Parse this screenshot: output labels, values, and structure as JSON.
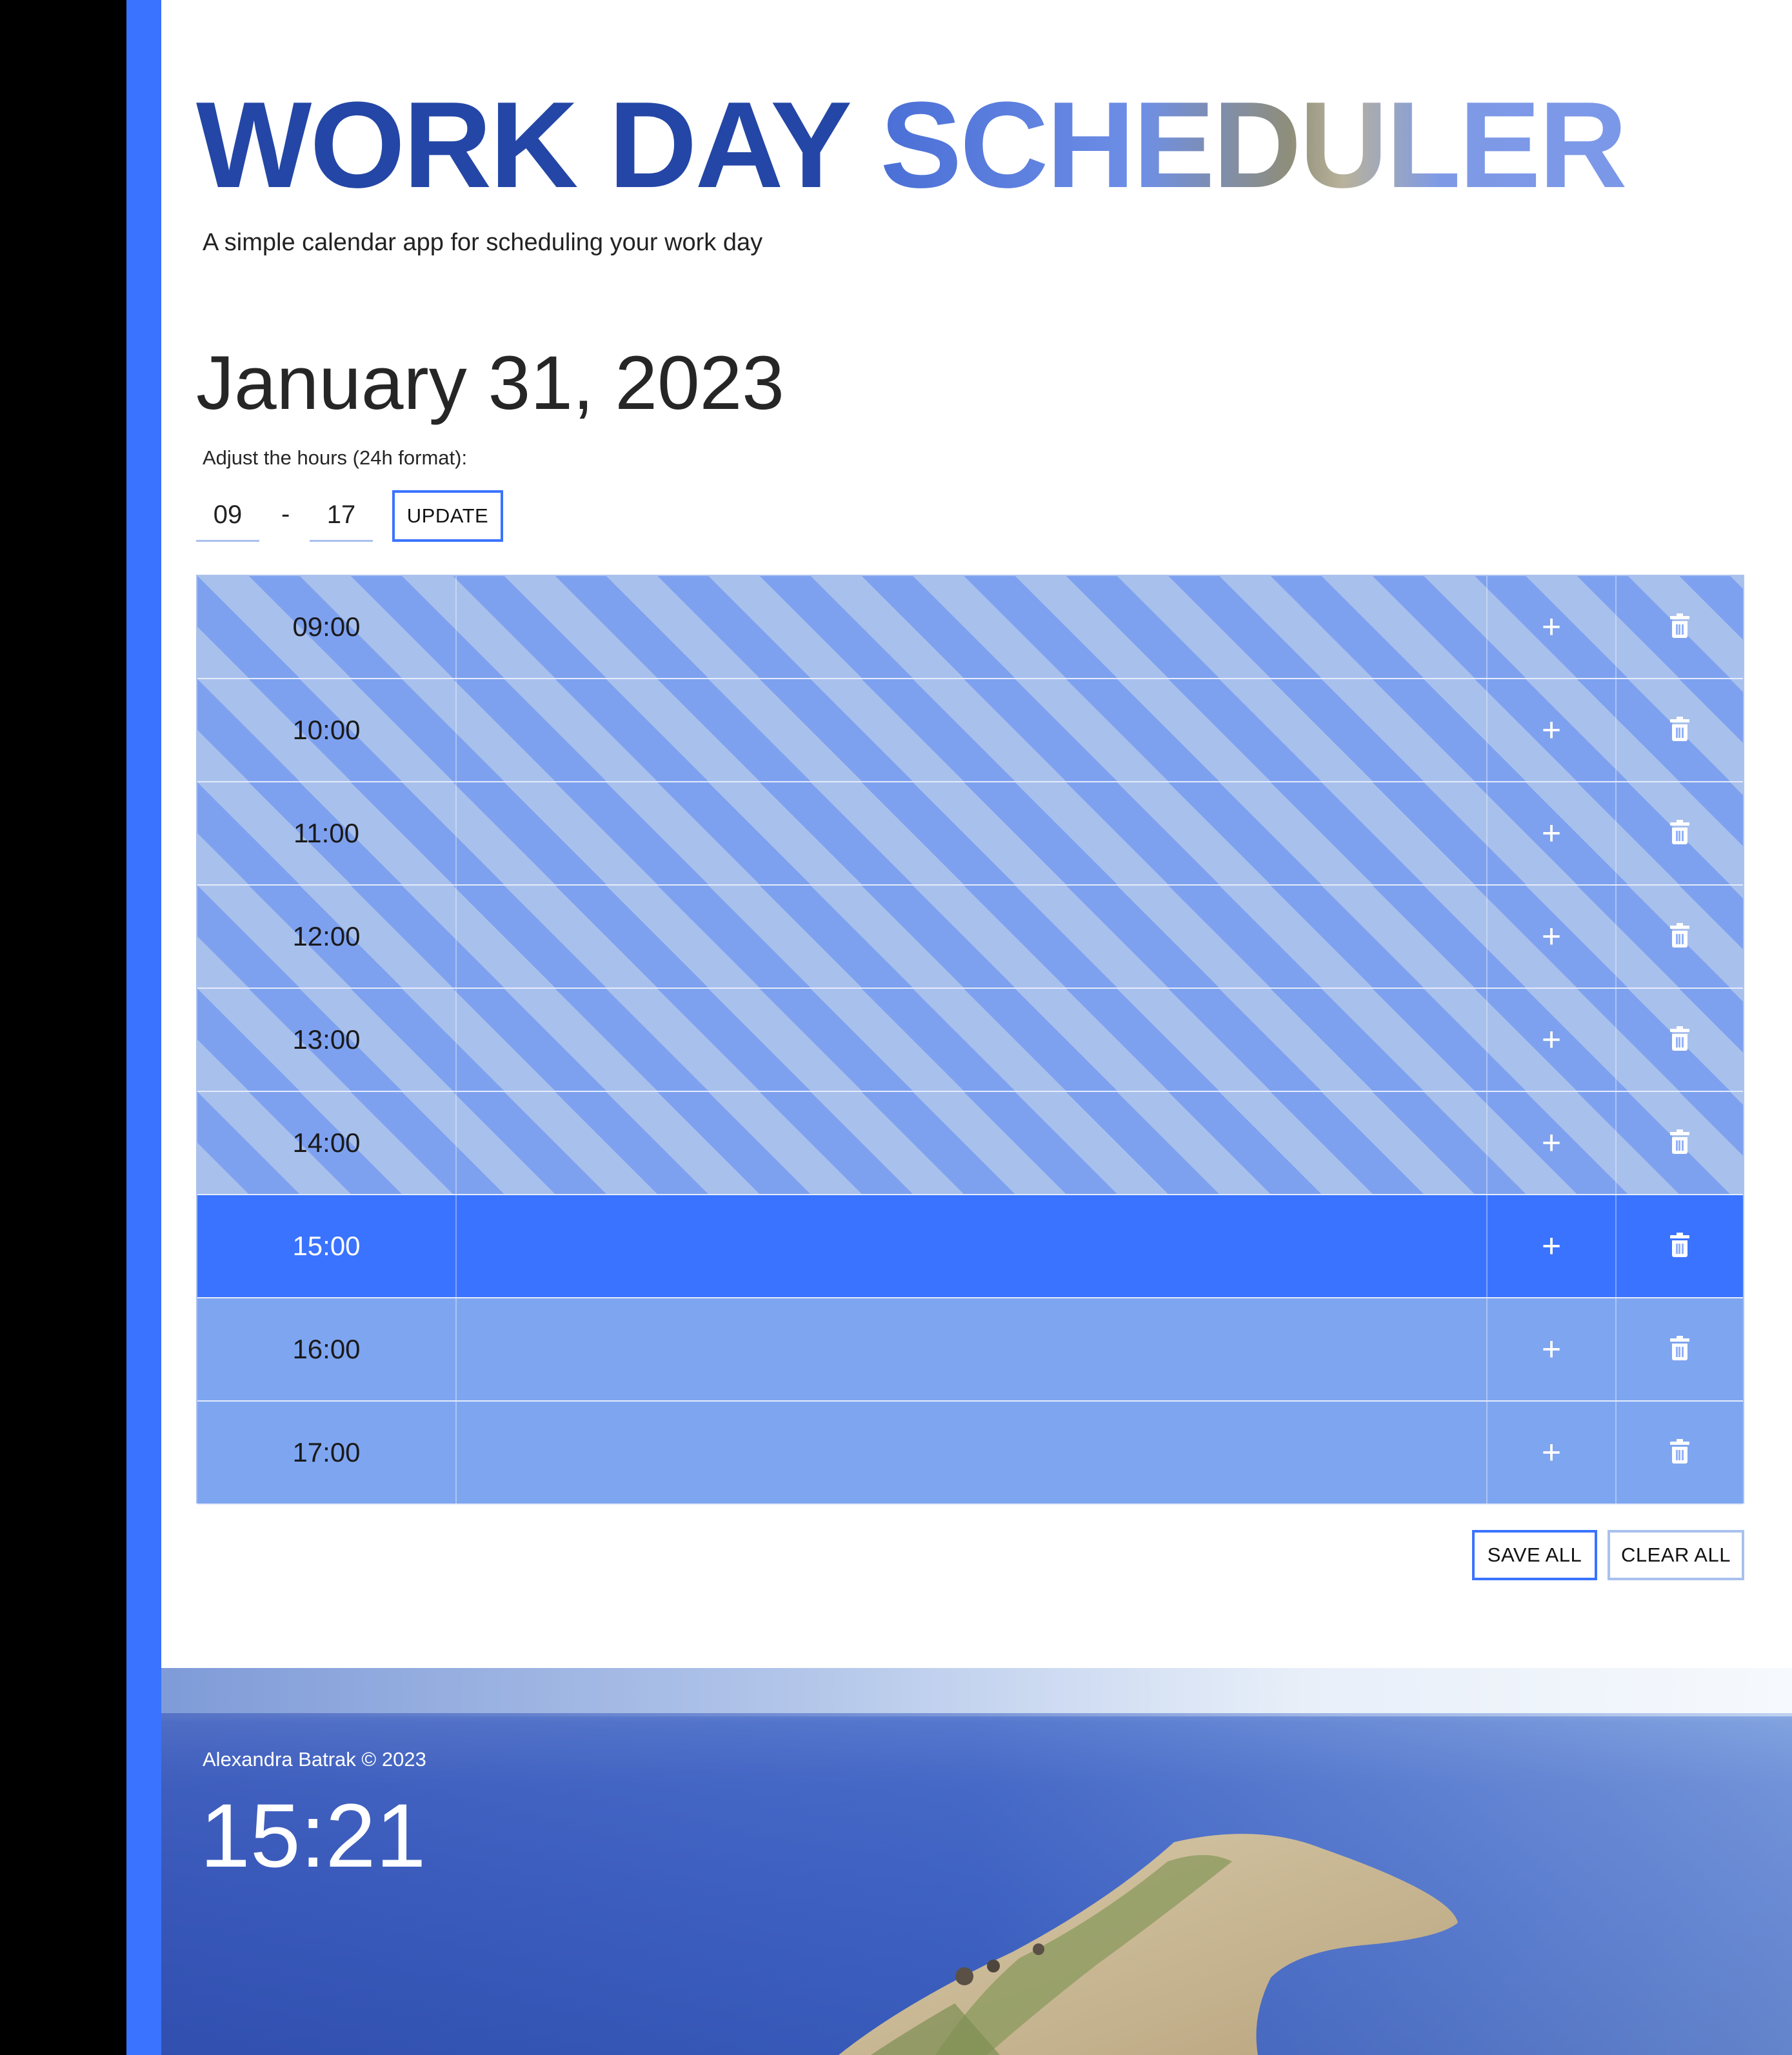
{
  "header": {
    "title_part1": "WORK DAY",
    "title_part2": "SCHEDULER",
    "subtitle": "A simple calendar app for scheduling your work day"
  },
  "date": "January 31, 2023",
  "hours": {
    "label": "Adjust the hours (24h format):",
    "start": "09",
    "separator": "-",
    "end": "17",
    "update_label": "UPDATE"
  },
  "schedule": {
    "rows": [
      {
        "time": "09:00",
        "state": "past",
        "task": ""
      },
      {
        "time": "10:00",
        "state": "past",
        "task": ""
      },
      {
        "time": "11:00",
        "state": "past",
        "task": ""
      },
      {
        "time": "12:00",
        "state": "past",
        "task": ""
      },
      {
        "time": "13:00",
        "state": "past",
        "task": ""
      },
      {
        "time": "14:00",
        "state": "past",
        "task": ""
      },
      {
        "time": "15:00",
        "state": "present",
        "task": ""
      },
      {
        "time": "16:00",
        "state": "future",
        "task": ""
      },
      {
        "time": "17:00",
        "state": "future",
        "task": ""
      }
    ],
    "add_symbol": "+",
    "add_icon": "plus-icon",
    "delete_icon": "trash-icon"
  },
  "actions": {
    "save_all_label": "SAVE ALL",
    "clear_all_label": "CLEAR ALL"
  },
  "footer": {
    "copyright": "Alexandra Batrak © 2023",
    "clock": "15:21"
  },
  "colors": {
    "accent": "#3a73ff",
    "title_blue": "#2446a6",
    "past_stripe_light": "#a8c0ec",
    "past_stripe_dark": "#7ea1ef",
    "present": "#3a73ff",
    "future": "#7ea5f0"
  }
}
